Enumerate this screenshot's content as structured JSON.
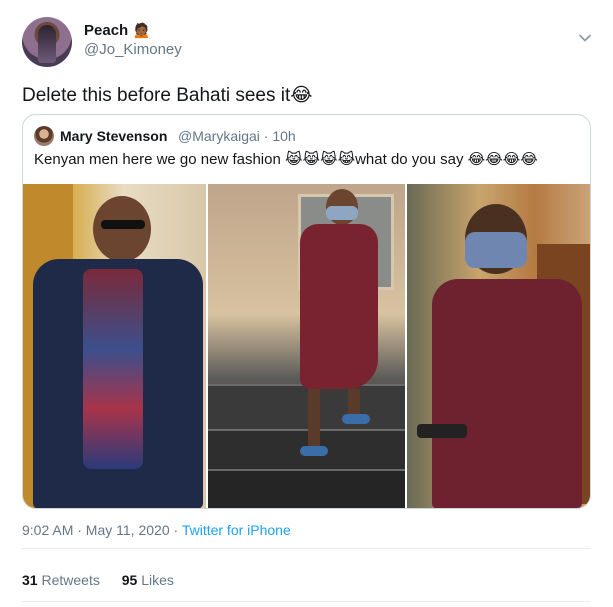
{
  "author": {
    "name": "Peach",
    "name_emoji": "🙍🏾",
    "handle": "@Jo_Kimoney"
  },
  "tweet": {
    "text": "Delete this before Bahati sees it😂"
  },
  "quoted": {
    "name": "Mary Stevenson",
    "meta": "@Marykaigai · 10h",
    "text": "Kenyan men here we go new fashion 😹😹😹😹what do you say 😂😂😂😂"
  },
  "footer": {
    "time": "9:02 AM · May 11, 2020",
    "separator": " · ",
    "source": "Twitter for iPhone",
    "retweets": "31",
    "retweets_label": "Retweets",
    "likes": "95",
    "likes_label": "Likes"
  },
  "icons": {
    "caret": "chevron-down-icon"
  },
  "colors": {
    "link": "#1da1f2",
    "secondary": "#657786",
    "border": "#ccd6dd"
  }
}
